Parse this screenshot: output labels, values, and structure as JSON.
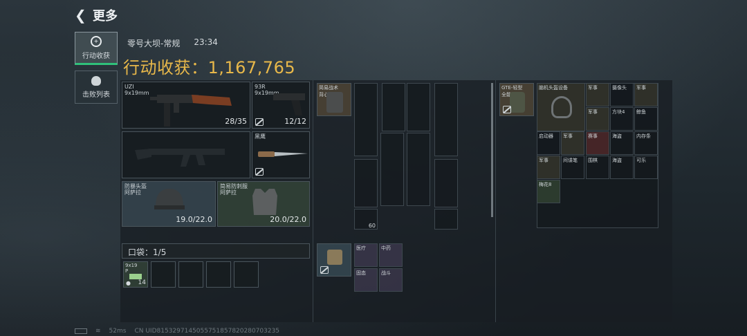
{
  "header": {
    "back_icon": "back-arrow-icon",
    "title": "更多"
  },
  "sidebar": {
    "items": [
      {
        "label": "行动收获",
        "icon": "target-icon",
        "active": true
      },
      {
        "label": "击败列表",
        "icon": "skull-icon",
        "active": false
      }
    ]
  },
  "match": {
    "map": "零号大坝-常规",
    "time": "23:34"
  },
  "loot": {
    "label": "行动收获：",
    "value": "1,167,765"
  },
  "weapons": {
    "primary": {
      "name": "UZI",
      "caliber": "9x19mm",
      "ammo": "28/35"
    },
    "sidearm": {
      "name": "93R",
      "caliber": "9x19mm",
      "ammo": "12/12"
    },
    "knife": {
      "name": "黑鹰"
    },
    "helmet": {
      "name": "防暴头盔",
      "sub": "阿萨拉",
      "durability": "19.0/22.0"
    },
    "armor": {
      "name": "简易防刺服",
      "sub": "阿萨拉",
      "durability": "20.0/22.0"
    }
  },
  "pouch": {
    "label": "口袋：",
    "count": "1/5",
    "item_name": "9x19",
    "item_sub": "P",
    "item_qty": "14"
  },
  "rig": {
    "name": "简易战术",
    "sub": "背心",
    "ammo_count": "60"
  },
  "small_bag": {
    "items": [
      "医疗",
      "中药",
      "固态",
      "战斗"
    ]
  },
  "backpack": {
    "name": "GTE-轻型",
    "sub": "全能战",
    "items": [
      "脑机头盔设备",
      "军事",
      "摄像头",
      "军事",
      "军事",
      "方块4",
      "鲸鱼",
      "启动器",
      "军事",
      "赛事",
      "海盗",
      "内存条",
      "军事",
      "间谍笔",
      "围棋",
      "海盗",
      "可乐",
      "梅花8"
    ]
  },
  "footer": {
    "ping": "52ms",
    "uid": "CN UID8153297145055751857820280703235"
  },
  "colors": {
    "accent": "#e8b84a",
    "active_tab": "#2fc17a"
  }
}
